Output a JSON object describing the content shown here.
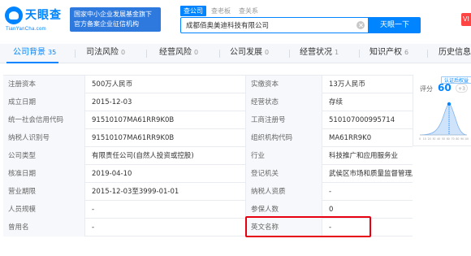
{
  "brand": {
    "name": "天眼查",
    "domain": "TianYanCha.com",
    "badge_line1": "国家中小企业发展基金旗下",
    "badge_line2": "官方备案企业征信机构"
  },
  "search": {
    "tabs": [
      "查公司",
      "查老板",
      "查关系"
    ],
    "active_tab": 0,
    "query": "成都佰奥美迪科技有限公司",
    "button_label": "天眼一下",
    "vip_label": "VI"
  },
  "nav": [
    {
      "label": "公司背景",
      "count": "35",
      "active": true
    },
    {
      "label": "司法风险",
      "count": "0",
      "active": false
    },
    {
      "label": "经营风险",
      "count": "0",
      "active": false
    },
    {
      "label": "公司发展",
      "count": "0",
      "active": false
    },
    {
      "label": "经营状况",
      "count": "1",
      "active": false
    },
    {
      "label": "知识产权",
      "count": "6",
      "active": false
    },
    {
      "label": "历史信息",
      "count": "",
      "active": false
    }
  ],
  "info_rows": [
    {
      "label1": "注册资本",
      "value1": "500万人民币",
      "label2": "实缴资本",
      "value2": "13万人民币"
    },
    {
      "label1": "成立日期",
      "value1": "2015-12-03",
      "label2": "经营状态",
      "value2": "存续"
    },
    {
      "label1": "统一社会信用代码",
      "value1": "91510107MA61RR9K0B",
      "label2": "工商注册号",
      "value2": "510107000995714"
    },
    {
      "label1": "纳税人识别号",
      "value1": "91510107MA61RR9K0B",
      "label2": "组织机构代码",
      "value2": "MA61RR9K0"
    },
    {
      "label1": "公司类型",
      "value1": "有限责任公司(自然人投资或控股)",
      "label2": "行业",
      "value2": "科技推广和应用服务业"
    },
    {
      "label1": "核准日期",
      "value1": "2019-04-10",
      "label2": "登记机关",
      "value2": "武侯区市场和质量监督管理局"
    },
    {
      "label1": "营业期限",
      "value1": "2015-12-03至3999-01-01",
      "label2": "纳税人资质",
      "value2": "-"
    },
    {
      "label1": "人员规模",
      "value1": "-",
      "label2": "参保人数",
      "value2": "0"
    },
    {
      "label1": "曾用名",
      "value1": "-",
      "label2": "英文名称",
      "value2": "-"
    }
  ],
  "score": {
    "cert_label": "认证后权益",
    "label": "评分",
    "value": "60",
    "delta": "+3",
    "chart_data": {
      "type": "area",
      "x_ticks": [
        "0",
        "10",
        "20",
        "30",
        "40",
        "50",
        "60",
        "70",
        "80",
        "90",
        "100"
      ],
      "highlight": 60
    }
  },
  "colors": {
    "accent": "#0084ff",
    "highlight": "#e60012"
  }
}
